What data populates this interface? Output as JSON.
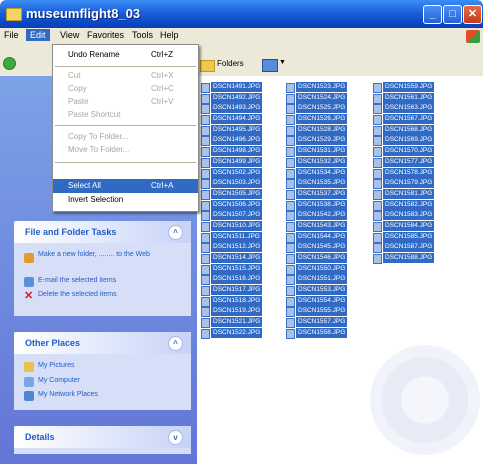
{
  "window": {
    "title": "museumflight8_03"
  },
  "menubar": {
    "items": [
      "File",
      "Edit",
      "View",
      "Favorites",
      "Tools",
      "Help"
    ]
  },
  "toolbar": {
    "back_label": "Back",
    "folders_label": "Folders"
  },
  "edit_menu": {
    "items": [
      {
        "label": "Undo Rename",
        "shortcut": "Ctrl+Z",
        "enabled": true
      },
      {
        "label": "Cut",
        "shortcut": "Ctrl+X",
        "enabled": false
      },
      {
        "label": "Copy",
        "shortcut": "Ctrl+C",
        "enabled": false
      },
      {
        "label": "Paste",
        "shortcut": "Ctrl+V",
        "enabled": false
      },
      {
        "label": "Paste Shortcut",
        "shortcut": "",
        "enabled": false
      },
      {
        "label": "Copy To Folder...",
        "shortcut": "",
        "enabled": false
      },
      {
        "label": "Move To Folder...",
        "shortcut": "",
        "enabled": false
      },
      {
        "label": "Select All",
        "shortcut": "Ctrl+A",
        "enabled": true,
        "selected": true
      },
      {
        "label": "Invert Selection",
        "shortcut": "",
        "enabled": true
      }
    ]
  },
  "tasks": {
    "file_and_folder": {
      "title": "File and Folder Tasks",
      "links": [
        "Make a new folder, ........ to the Web",
        "E-mail the selected items",
        "Delete the selected items"
      ]
    },
    "other_places": {
      "title": "Other Places",
      "links": [
        "My Pictures",
        "My Computer",
        "My Network Places"
      ]
    },
    "details": {
      "title": "Details"
    }
  },
  "files": {
    "col1": [
      "DSCN1491.JPG",
      "DSCN1492.JPG",
      "DSCN1493.JPG",
      "DSCN1494.JPG",
      "DSCN1495.JPG",
      "DSCN1496.JPG",
      "DSCN1498.JPG",
      "DSCN1499.JPG",
      "DSCN1502.JPG",
      "DSCN1503.JPG",
      "DSCN1505.JPG",
      "DSCN1506.JPG",
      "DSCN1507.JPG",
      "DSCN1510.JPG",
      "DSCN1511.JPG",
      "DSCN1512.JPG",
      "DSCN1514.JPG",
      "DSCN1515.JPG",
      "DSCN1516.JPG",
      "DSCN1517.JPG",
      "DSCN1518.JPG",
      "DSCN1519.JPG",
      "DSCN1521.JPG",
      "DSCN1522.JPG"
    ],
    "col2": [
      "DSCN1523.JPG",
      "DSCN1524.JPG",
      "DSCN1525.JPG",
      "DSCN1526.JPG",
      "DSCN1528.JPG",
      "DSCN1529.JPG",
      "DSCN1531.JPG",
      "DSCN1532.JPG",
      "DSCN1534.JPG",
      "DSCN1535.JPG",
      "DSCN1537.JPG",
      "DSCN1538.JPG",
      "DSCN1542.JPG",
      "DSCN1543.JPG",
      "DSCN1544.JPG",
      "DSCN1545.JPG",
      "DSCN1546.JPG",
      "DSCN1550.JPG",
      "DSCN1551.JPG",
      "DSCN1553.JPG",
      "DSCN1554.JPG",
      "DSCN1555.JPG",
      "DSCN1557.JPG",
      "DSCN1558.JPG"
    ],
    "col3": [
      "DSCN1559.JPG",
      "DSCN1561.JPG",
      "DSCN1563.JPG",
      "DSCN1567.JPG",
      "DSCN1568.JPG",
      "DSCN1569.JPG",
      "DSCN1570.JPG",
      "DSCN1577.JPG",
      "DSCN1578.JPG",
      "DSCN1579.JPG",
      "DSCN1581.JPG",
      "DSCN1582.JPG",
      "DSCN1583.JPG",
      "DSCN1584.JPG",
      "DSCN1585.JPG",
      "DSCN1587.JPG",
      "DSCN1588.JPG"
    ]
  },
  "colors": {
    "selection": "#316ac5",
    "titlebar": "#0a48c6",
    "taskpane": "#7ba2e7",
    "link": "#215dc6"
  }
}
